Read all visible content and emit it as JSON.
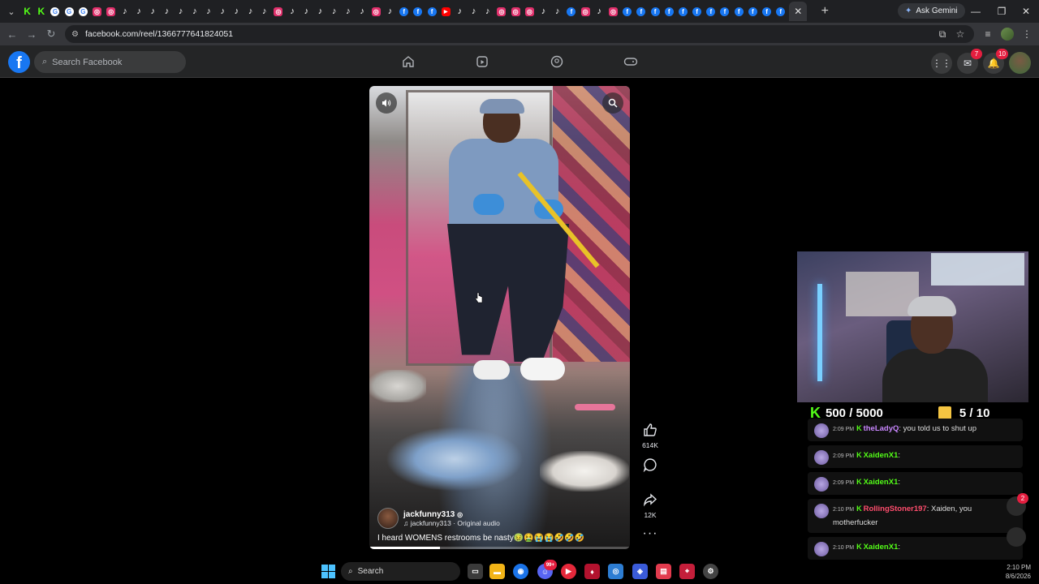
{
  "browser": {
    "tab_favicons": [
      "kick",
      "kick",
      "google",
      "google",
      "google",
      "instagram",
      "instagram",
      "tiktok",
      "tiktok",
      "tiktok",
      "tiktok",
      "tiktok",
      "tiktok",
      "tiktok",
      "tiktok",
      "tiktok",
      "tiktok",
      "tiktok",
      "instagram",
      "tiktok",
      "tiktok",
      "tiktok",
      "tiktok",
      "tiktok",
      "tiktok",
      "instagram",
      "tiktok",
      "facebook",
      "facebook",
      "facebook",
      "youtube",
      "tiktok",
      "tiktok",
      "tiktok",
      "instagram",
      "instagram",
      "instagram",
      "tiktok",
      "tiktok",
      "facebook",
      "instagram",
      "tiktok",
      "instagram",
      "facebook",
      "facebook",
      "facebook",
      "facebook",
      "facebook",
      "facebook",
      "facebook",
      "facebook",
      "facebook",
      "facebook",
      "facebook",
      "facebook"
    ],
    "active_tab_close": "✕",
    "new_tab": "+",
    "gemini_label": "Ask Gemini",
    "url": "facebook.com/reel/1366777641824051",
    "colors": {
      "tabstrip": "#1f2023",
      "toolbar": "#35363a"
    }
  },
  "facebook": {
    "logo": "f",
    "search_placeholder": "Search Facebook",
    "nav_icons": [
      "home-icon",
      "video-icon",
      "groups-icon",
      "gaming-icon"
    ],
    "messenger_badge": "7",
    "notifications_badge": "10"
  },
  "reel": {
    "author": "jackfunny313",
    "audio": "jackfunny313 · Original audio",
    "caption": "I heard WOMENS restrooms be nasty🤢🤮😭😭🤣🤣🤣",
    "likes": "614K",
    "shares": "12K",
    "progress": 0.27
  },
  "stream": {
    "kick_goal": "500 / 5000",
    "gift_goal": "5 / 10",
    "messages": [
      {
        "time": "2:09 PM",
        "user": "theLadyQ",
        "user_color": "#c987ff",
        "text": ": you told us to shut up"
      },
      {
        "time": "2:09 PM",
        "user": "XaidenX1",
        "user_color": "#53fc18",
        "text": ":"
      },
      {
        "time": "2:09 PM",
        "user": "XaidenX1",
        "user_color": "#53fc18",
        "text": ":"
      },
      {
        "time": "2:10 PM",
        "user": "RollingStoner197",
        "user_color": "#ff4d6d",
        "text": ": Xaiden, you motherfucker"
      },
      {
        "time": "2:10 PM",
        "user": "XaidenX1",
        "user_color": "#53fc18",
        "text": ":"
      }
    ],
    "side_badge": "2"
  },
  "taskbar": {
    "search_label": "Search",
    "time": "2:10 PM",
    "date": "8/6/2026",
    "discord_badge": "99+"
  }
}
